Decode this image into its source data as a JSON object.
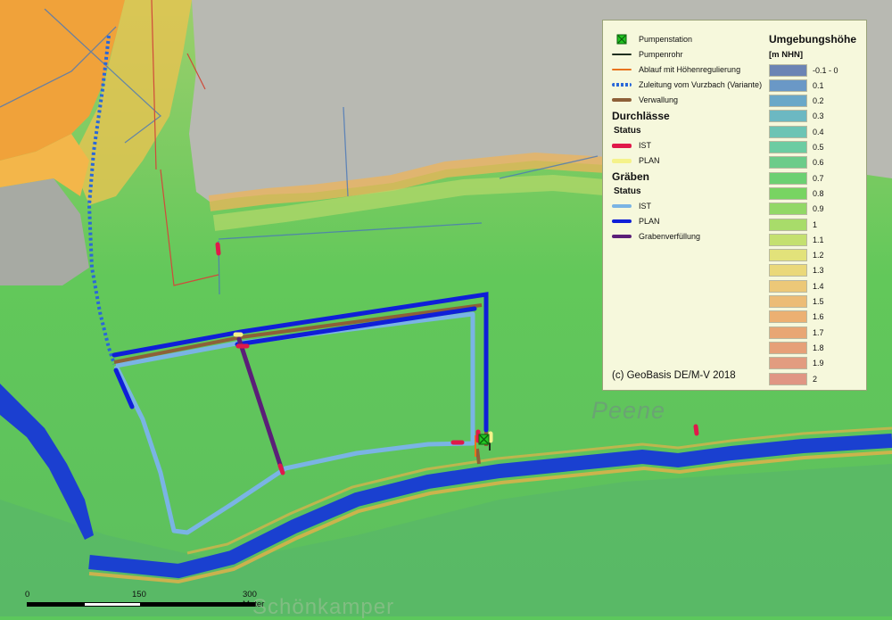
{
  "legend": {
    "items": [
      {
        "label": "Pumpenstation",
        "icon": "pump-station-icon",
        "color": "#22c522"
      },
      {
        "label": "Pumpenrohr",
        "color": "#1f2f1f"
      },
      {
        "label": "Ablauf mit Höhenregulierung",
        "color": "#e8741e"
      },
      {
        "label": "Zuleitung vom Vurzbach (Variante)",
        "color": "#2a68d8"
      },
      {
        "label": "Verwallung",
        "color": "#8d6038"
      }
    ],
    "durchlaesse": {
      "heading": "Durchlässe",
      "status": "Status",
      "items": [
        {
          "label": "IST",
          "color": "#e0194a"
        },
        {
          "label": "PLAN",
          "color": "#f5f28a"
        }
      ]
    },
    "graeben": {
      "heading": "Gräben",
      "status": "Status",
      "items": [
        {
          "label": "IST",
          "color": "#7ab4e4"
        },
        {
          "label": "PLAN",
          "color": "#0f1fd8"
        },
        {
          "label": "Grabenverfüllung",
          "color": "#5b1f78"
        }
      ]
    },
    "elevation": {
      "title": "Umgebungshöhe",
      "unit": "[m NHN]",
      "classes": [
        {
          "label": "-0.1 - 0",
          "color": "#6c84b4"
        },
        {
          "label": "0.1",
          "color": "#6a98c6"
        },
        {
          "label": "0.2",
          "color": "#6aa8c8"
        },
        {
          "label": "0.3",
          "color": "#6cb8c2"
        },
        {
          "label": "0.4",
          "color": "#6cc4b4"
        },
        {
          "label": "0.5",
          "color": "#6ccca2"
        },
        {
          "label": "0.6",
          "color": "#6ccc8a"
        },
        {
          "label": "0.7",
          "color": "#6cd072"
        },
        {
          "label": "0.8",
          "color": "#78d462"
        },
        {
          "label": "0.9",
          "color": "#92d866"
        },
        {
          "label": "1",
          "color": "#a8dc6a"
        },
        {
          "label": "1.1",
          "color": "#c4e070"
        },
        {
          "label": "1.2",
          "color": "#e2e27a"
        },
        {
          "label": "1.3",
          "color": "#ead87a"
        },
        {
          "label": "1.4",
          "color": "#ecc878"
        },
        {
          "label": "1.5",
          "color": "#ecbc76"
        },
        {
          "label": "1.6",
          "color": "#ecb072"
        },
        {
          "label": "1.7",
          "color": "#e8a674"
        },
        {
          "label": "1.8",
          "color": "#e6a078"
        },
        {
          "label": "1.9",
          "color": "#e29c80"
        },
        {
          "label": "2",
          "color": "#e09684"
        }
      ]
    },
    "copyright": "(c) GeoBasis DE/M-V 2018"
  },
  "scalebar": {
    "labels": [
      "0",
      "150",
      "300 Meter"
    ]
  },
  "place_labels": {
    "river": "Peene",
    "village": "Schönkamper"
  }
}
